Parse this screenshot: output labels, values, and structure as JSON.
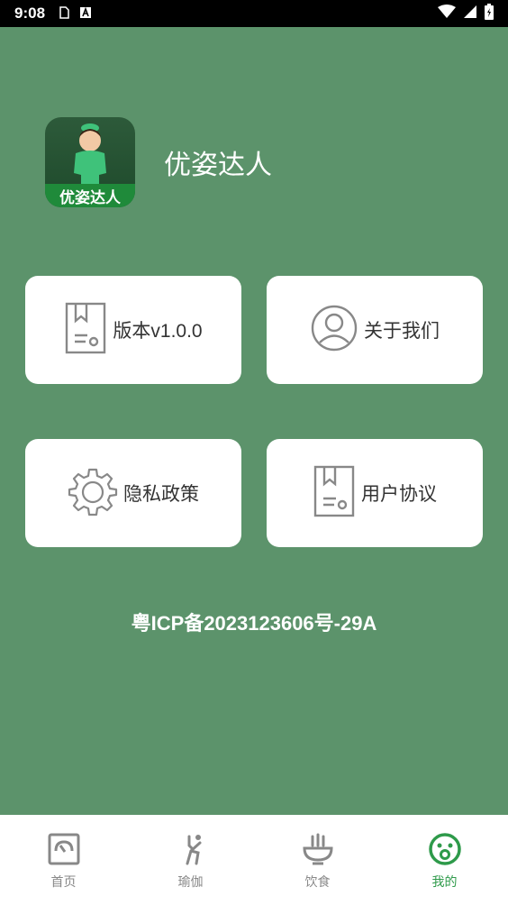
{
  "status_bar": {
    "time": "9:08"
  },
  "app": {
    "name": "优姿达人",
    "logo_text": "优姿达人"
  },
  "cards": {
    "version": "版本v1.0.0",
    "about": "关于我们",
    "privacy": "隐私政策",
    "agreement": "用户协议"
  },
  "icp": "粤ICP备2023123606号-29A",
  "nav": {
    "items": [
      {
        "label": "首页",
        "icon": "home-gauge-icon"
      },
      {
        "label": "瑜伽",
        "icon": "yoga-icon"
      },
      {
        "label": "饮食",
        "icon": "food-bowl-icon"
      },
      {
        "label": "我的",
        "icon": "smiley-profile-icon"
      }
    ],
    "active_index": 3
  },
  "colors": {
    "background": "#5c936b",
    "active_nav": "#2e9a4a",
    "card_icon": "#888888"
  }
}
